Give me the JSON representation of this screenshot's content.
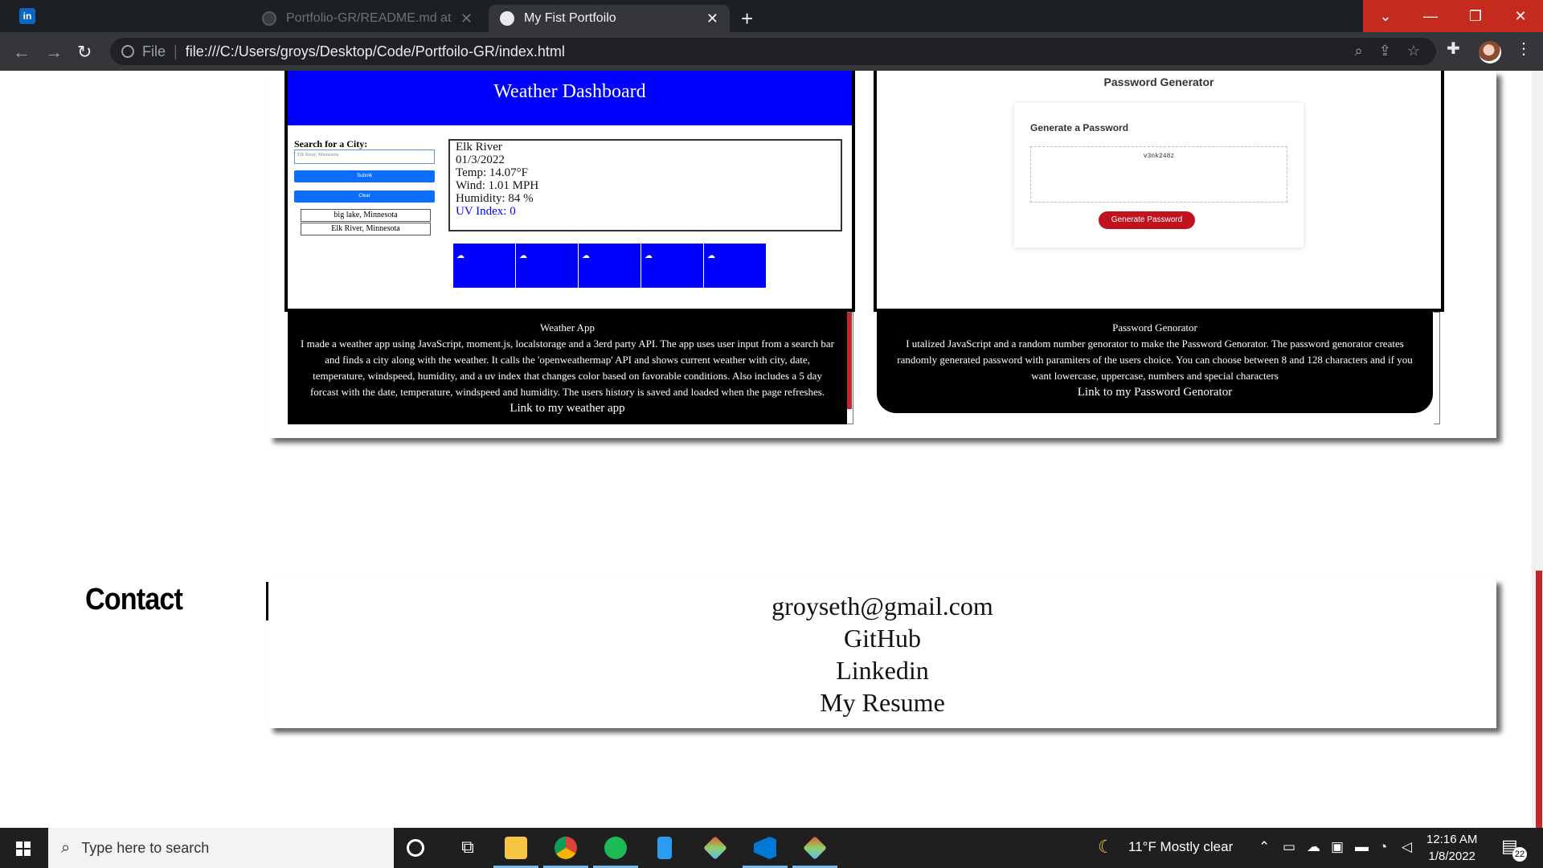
{
  "browser": {
    "tabs": [
      {
        "title": "Portfolio-GR/README.md at ma",
        "active": false
      },
      {
        "title": "My Fist Portfoilo",
        "active": true
      }
    ],
    "address": {
      "scheme_label": "File",
      "url": "file:///C:/Users/groys/Desktop/Code/Portfoilo-GR/index.html"
    }
  },
  "weather_preview": {
    "header": "Weather Dashboard",
    "search_label": "Search for a City:",
    "search_value": "Elk River, Minnesota",
    "submit_label": "Submit",
    "clear_label": "Clear",
    "history": [
      "big lake, Minnesota",
      "Elk River, Minnesota"
    ],
    "current": {
      "city": "Elk River",
      "date": "01/3/2022",
      "temp": "Temp: 14.07°F",
      "wind": "Wind: 1.01 MPH",
      "humidity": "Humidity: 84 %",
      "uv": "UV Index: 0"
    }
  },
  "password_preview": {
    "title": "Password Generator",
    "card_title": "Generate a Password",
    "password": "v3nk248z",
    "button": "Generate Password"
  },
  "projects": [
    {
      "title": "Weather App",
      "description": "I made a weather app using JavaScript, moment.js, localstorage and a 3erd party API. The app uses user input from a search bar and finds a city along with the weather. It calls the 'openweathermap' API and shows current weather with city, date, temperature, windspeed, humidity, and a uv index that changes color based on favorable conditions. Also includes a 5 day forcast with the date, temperature, windspeed and humidity. The users history is saved and loaded when the page refreshes.",
      "link": "Link to my weather app"
    },
    {
      "title": "Password Genorator",
      "description": "I utalized JavaScript and a random number genorator to make the Password Genorator. The password genorator creates randomly generated password with paramiters of the users choice. You can choose between 8 and 128 characters and if you want lowercase, uppercase, numbers and special characters",
      "link": "Link to my Password Genorator"
    }
  ],
  "contact": {
    "heading": "Contact",
    "email": "groyseth@gmail.com",
    "github": "GitHub",
    "linkedin": "Linkedin",
    "resume": "My Resume"
  },
  "taskbar": {
    "search_placeholder": "Type here to search",
    "weather": "11°F  Mostly clear",
    "time": "12:16 AM",
    "date": "1/8/2022",
    "notifications": "22"
  },
  "colors": {
    "weather_blue": "#0000ff",
    "accent_red": "#c1272d",
    "password_red": "#c1121f"
  }
}
